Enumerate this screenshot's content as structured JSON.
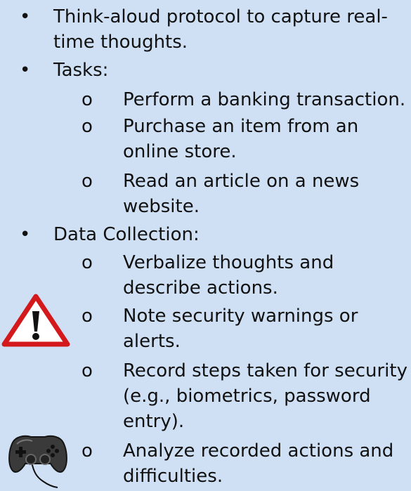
{
  "items": [
    {
      "bullet": "•",
      "lines": [
        "Think-aloud protocol to capture real-",
        "time thoughts."
      ]
    },
    {
      "bullet": "•",
      "lines": [
        "Tasks:"
      ]
    },
    {
      "bullet": "o",
      "lines": [
        "Perform a banking transaction."
      ]
    },
    {
      "bullet": "o",
      "lines": [
        "Purchase an item from an",
        "online store."
      ]
    },
    {
      "bullet": "o",
      "lines": [
        "Read an article on a news",
        "website."
      ]
    },
    {
      "bullet": "•",
      "lines": [
        "Data Collection:"
      ]
    },
    {
      "bullet": "o",
      "lines": [
        "Verbalize thoughts and",
        "describe actions."
      ]
    },
    {
      "bullet": "o",
      "lines": [
        "Note security warnings or",
        "alerts."
      ]
    },
    {
      "bullet": "o",
      "lines": [
        "Record steps taken for security",
        "(e.g., biometrics, password",
        "entry)."
      ]
    },
    {
      "bullet": "o",
      "lines": [
        "Analyze recorded actions and",
        "difficulties."
      ]
    }
  ],
  "icons": {
    "warning": "warning-triangle-icon",
    "controller": "game-controller-icon"
  }
}
